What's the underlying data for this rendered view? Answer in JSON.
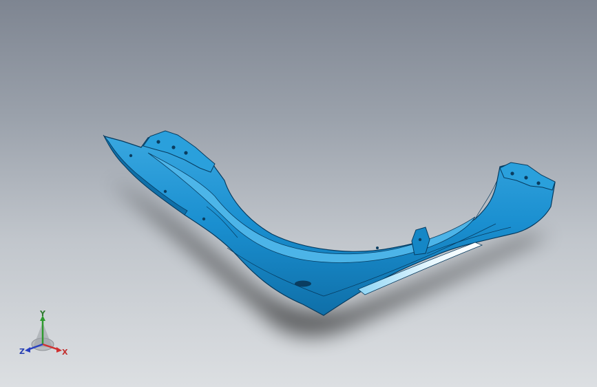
{
  "viewport": {
    "background_top": "#7e8591",
    "background_bottom": "#dcdfe2"
  },
  "model": {
    "color": "#1a8fd0",
    "edge_color": "#063a5e",
    "highlight_color": "#d9f3ff"
  },
  "triad": {
    "icon": "view-orientation-triad-icon",
    "axis_y_label": "Y",
    "axis_x_label": "X",
    "axis_z_label": "Z",
    "axis_y_color": "#2f9a2f",
    "axis_x_color": "#d03030",
    "axis_z_color": "#2840c0"
  }
}
